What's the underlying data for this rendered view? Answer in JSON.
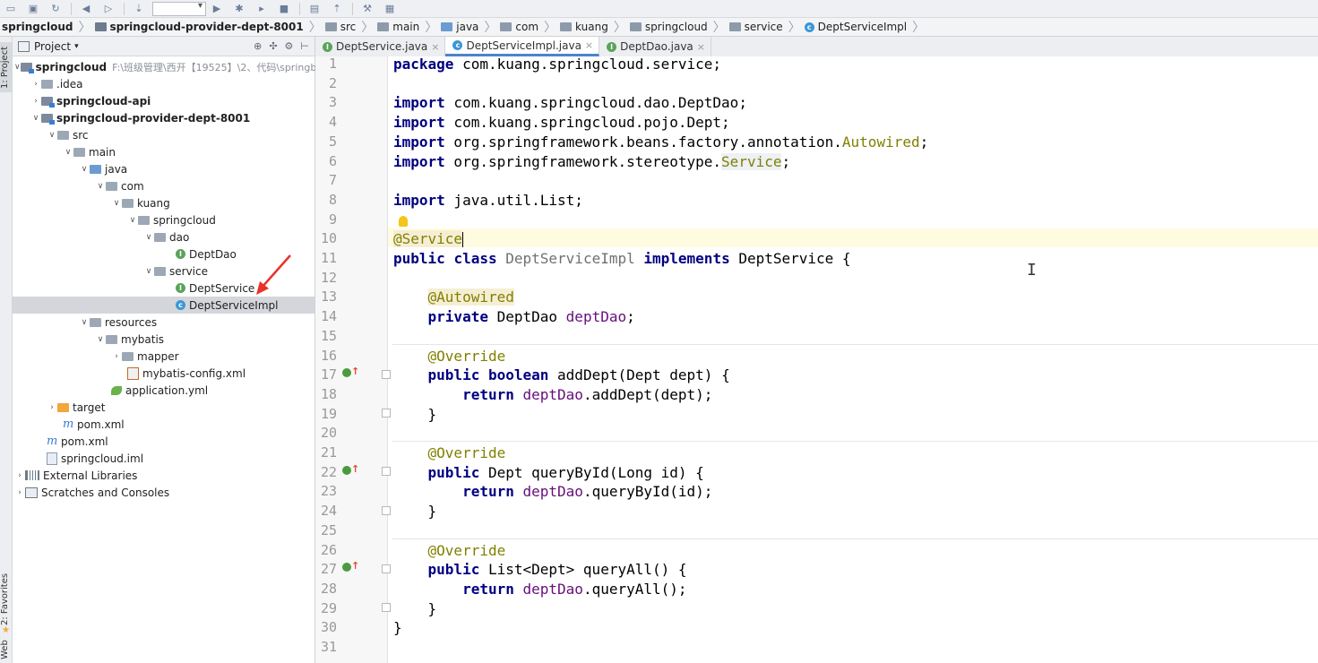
{
  "breadcrumb": [
    "springcloud",
    "springcloud-provider-dept-8001",
    "src",
    "main",
    "java",
    "com",
    "kuang",
    "springcloud",
    "service",
    "DeptServiceImpl"
  ],
  "side_tabs": {
    "project": "1: Project",
    "favorites": "2: Favorites",
    "web": "Web"
  },
  "project_panel": {
    "title": "Project",
    "tree": [
      {
        "label": "springcloud",
        "suffix": "F:\\班级管理\\西开【19525】\\2、代码\\springbo"
      },
      {
        "label": ".idea"
      },
      {
        "label": "springcloud-api"
      },
      {
        "label": "springcloud-provider-dept-8001"
      },
      {
        "label": "src"
      },
      {
        "label": "main"
      },
      {
        "label": "java"
      },
      {
        "label": "com"
      },
      {
        "label": "kuang"
      },
      {
        "label": "springcloud"
      },
      {
        "label": "dao"
      },
      {
        "label": "DeptDao"
      },
      {
        "label": "service"
      },
      {
        "label": "DeptService"
      },
      {
        "label": "DeptServiceImpl"
      },
      {
        "label": "resources"
      },
      {
        "label": "mybatis"
      },
      {
        "label": "mapper"
      },
      {
        "label": "mybatis-config.xml"
      },
      {
        "label": "application.yml"
      },
      {
        "label": "target"
      },
      {
        "label": "pom.xml"
      },
      {
        "label": "pom.xml"
      },
      {
        "label": "springcloud.iml"
      },
      {
        "label": "External Libraries"
      },
      {
        "label": "Scratches and Consoles"
      }
    ]
  },
  "editor_tabs": [
    {
      "label": "DeptService.java",
      "active": false
    },
    {
      "label": "DeptServiceImpl.java",
      "active": true
    },
    {
      "label": "DeptDao.java",
      "active": false
    }
  ],
  "code": {
    "line_numbers": [
      "1",
      "2",
      "3",
      "4",
      "5",
      "6",
      "7",
      "8",
      "9",
      "10",
      "11",
      "12",
      "13",
      "14",
      "15",
      "16",
      "17",
      "18",
      "19",
      "20",
      "21",
      "22",
      "23",
      "24",
      "25",
      "26",
      "27",
      "28",
      "29",
      "30",
      "31"
    ],
    "t": {
      "package": "package",
      "pkg_name": " com.kuang.springcloud.service;",
      "import": "import",
      "imp3": " com.kuang.springcloud.dao.DeptDao;",
      "imp4": " com.kuang.springcloud.pojo.Dept;",
      "imp5a": " org.springframework.beans.factory.annotation.",
      "imp5b": "Autowired",
      "imp6a": " org.springframework.stereotype.",
      "imp6b": "Service",
      "imp8": " java.util.List;",
      "semicolon": ";",
      "at_service": "@Service",
      "public": "public",
      "class": "class",
      "implements": "implements",
      "private": "private",
      "boolean": "boolean",
      "return": "return",
      "cls_name": " DeptServiceImpl ",
      "iface": " DeptService {",
      "at_autowired": "@Autowired",
      "dept_dao_type": " DeptDao ",
      "dept_dao_field": "deptDao",
      "at_override": "@Override",
      "add_sig": " addDept(Dept dept) {",
      "add_call": ".addDept(dept);",
      "close_brace": "}",
      "dept_type": " Dept queryById(Long id) {",
      "query_call": ".queryById(id);",
      "list_sig": " List<Dept> queryAll() {",
      "all_call": ".queryAll();"
    }
  }
}
